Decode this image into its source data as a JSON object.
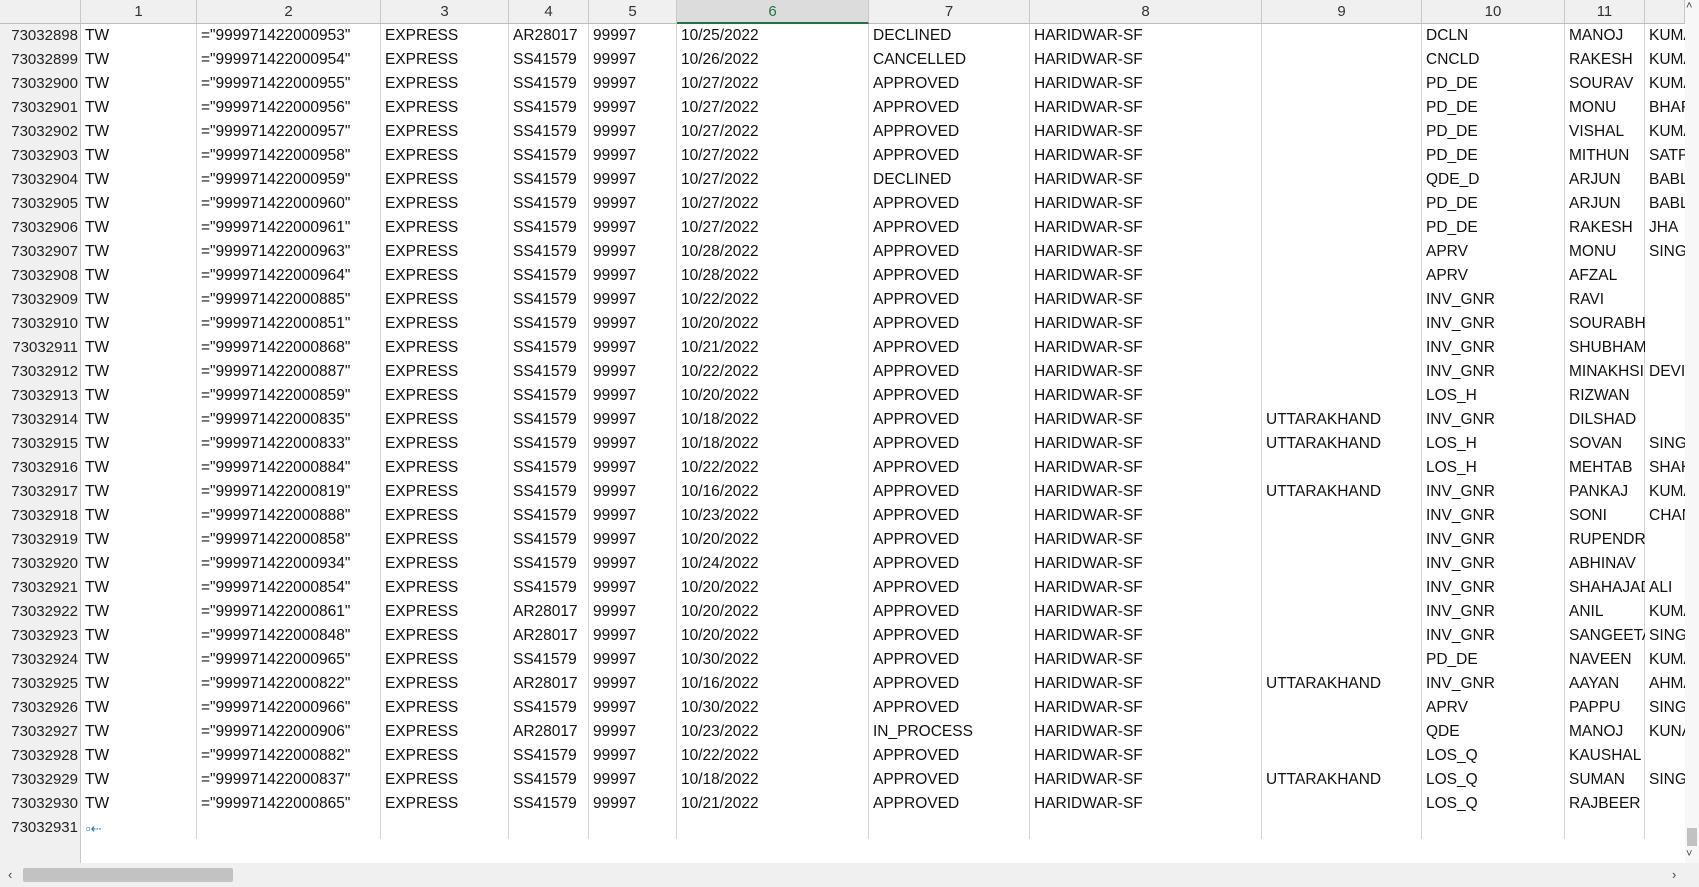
{
  "columns": [
    "1",
    "2",
    "3",
    "4",
    "5",
    "6",
    "7",
    "8",
    "9",
    "10",
    "11"
  ],
  "selected_column": "6",
  "rows": [
    {
      "id": "73032898",
      "cells": [
        "TW",
        "=\"999971422000953\"",
        "EXPRESS",
        "AR28017",
        "99997",
        "10/25/2022",
        "DECLINED",
        "HARIDWAR-SF",
        "",
        "DCLN",
        "MANOJ",
        "KUMAR"
      ]
    },
    {
      "id": "73032899",
      "cells": [
        "TW",
        "=\"999971422000954\"",
        "EXPRESS",
        "SS41579",
        "99997",
        "10/26/2022",
        "CANCELLED",
        "HARIDWAR-SF",
        "",
        "CNCLD",
        "RAKESH",
        "KUMAR"
      ]
    },
    {
      "id": "73032900",
      "cells": [
        "TW",
        "=\"999971422000955\"",
        "EXPRESS",
        "SS41579",
        "99997",
        "10/27/2022",
        "APPROVED",
        "HARIDWAR-SF",
        "",
        "PD_DE",
        "SOURAV",
        "KUMAR"
      ]
    },
    {
      "id": "73032901",
      "cells": [
        "TW",
        "=\"999971422000956\"",
        "EXPRESS",
        "SS41579",
        "99997",
        "10/27/2022",
        "APPROVED",
        "HARIDWAR-SF",
        "",
        "PD_DE",
        "MONU",
        "BHARDWAJ"
      ]
    },
    {
      "id": "73032902",
      "cells": [
        "TW",
        "=\"999971422000957\"",
        "EXPRESS",
        "SS41579",
        "99997",
        "10/27/2022",
        "APPROVED",
        "HARIDWAR-SF",
        "",
        "PD_DE",
        "VISHAL",
        "KUMAR"
      ]
    },
    {
      "id": "73032903",
      "cells": [
        "TW",
        "=\"999971422000958\"",
        "EXPRESS",
        "SS41579",
        "99997",
        "10/27/2022",
        "APPROVED",
        "HARIDWAR-SF",
        "",
        "PD_DE",
        "MITHUN",
        "SATPATHY"
      ]
    },
    {
      "id": "73032904",
      "cells": [
        "TW",
        "=\"999971422000959\"",
        "EXPRESS",
        "SS41579",
        "99997",
        "10/27/2022",
        "DECLINED",
        "HARIDWAR-SF",
        "",
        "QDE_D",
        "ARJUN",
        "BABLU"
      ]
    },
    {
      "id": "73032905",
      "cells": [
        "TW",
        "=\"999971422000960\"",
        "EXPRESS",
        "SS41579",
        "99997",
        "10/27/2022",
        "APPROVED",
        "HARIDWAR-SF",
        "",
        "PD_DE",
        "ARJUN",
        "BABLU"
      ]
    },
    {
      "id": "73032906",
      "cells": [
        "TW",
        "=\"999971422000961\"",
        "EXPRESS",
        "SS41579",
        "99997",
        "10/27/2022",
        "APPROVED",
        "HARIDWAR-SF",
        "",
        "PD_DE",
        "RAKESH",
        "JHA"
      ]
    },
    {
      "id": "73032907",
      "cells": [
        "TW",
        "=\"999971422000963\"",
        "EXPRESS",
        "SS41579",
        "99997",
        "10/28/2022",
        "APPROVED",
        "HARIDWAR-SF",
        "",
        "APRV",
        "MONU",
        "SINGH"
      ]
    },
    {
      "id": "73032908",
      "cells": [
        "TW",
        "=\"999971422000964\"",
        "EXPRESS",
        "SS41579",
        "99997",
        "10/28/2022",
        "APPROVED",
        "HARIDWAR-SF",
        "",
        "APRV",
        "AFZAL",
        ""
      ]
    },
    {
      "id": "73032909",
      "cells": [
        "TW",
        "=\"999971422000885\"",
        "EXPRESS",
        "SS41579",
        "99997",
        "10/22/2022",
        "APPROVED",
        "HARIDWAR-SF",
        "",
        "INV_GNR",
        "RAVI",
        ""
      ]
    },
    {
      "id": "73032910",
      "cells": [
        "TW",
        "=\"999971422000851\"",
        "EXPRESS",
        "SS41579",
        "99997",
        "10/20/2022",
        "APPROVED",
        "HARIDWAR-SF",
        "",
        "INV_GNR",
        "SOURABH",
        ""
      ]
    },
    {
      "id": "73032911",
      "cells": [
        "TW",
        "=\"999971422000868\"",
        "EXPRESS",
        "SS41579",
        "99997",
        "10/21/2022",
        "APPROVED",
        "HARIDWAR-SF",
        "",
        "INV_GNR",
        "SHUBHAM",
        ""
      ]
    },
    {
      "id": "73032912",
      "cells": [
        "TW",
        "=\"999971422000887\"",
        "EXPRESS",
        "SS41579",
        "99997",
        "10/22/2022",
        "APPROVED",
        "HARIDWAR-SF",
        "",
        "INV_GNR",
        "MINAKHSI",
        "DEVI"
      ]
    },
    {
      "id": "73032913",
      "cells": [
        "TW",
        "=\"999971422000859\"",
        "EXPRESS",
        "SS41579",
        "99997",
        "10/20/2022",
        "APPROVED",
        "HARIDWAR-SF",
        "",
        "LOS_H",
        "RIZWAN",
        ""
      ]
    },
    {
      "id": "73032914",
      "cells": [
        "TW",
        "=\"999971422000835\"",
        "EXPRESS",
        "SS41579",
        "99997",
        "10/18/2022",
        "APPROVED",
        "HARIDWAR-SF",
        "UTTARAKHAND",
        "INV_GNR",
        "DILSHAD",
        ""
      ]
    },
    {
      "id": "73032915",
      "cells": [
        "TW",
        "=\"999971422000833\"",
        "EXPRESS",
        "SS41579",
        "99997",
        "10/18/2022",
        "APPROVED",
        "HARIDWAR-SF",
        "UTTARAKHAND",
        "LOS_H",
        "SOVAN",
        "SINGH"
      ]
    },
    {
      "id": "73032916",
      "cells": [
        "TW",
        "=\"999971422000884\"",
        "EXPRESS",
        "SS41579",
        "99997",
        "10/22/2022",
        "APPROVED",
        "HARIDWAR-SF",
        "",
        "LOS_H",
        "MEHTAB",
        "SHAH"
      ]
    },
    {
      "id": "73032917",
      "cells": [
        "TW",
        "=\"999971422000819\"",
        "EXPRESS",
        "SS41579",
        "99997",
        "10/16/2022",
        "APPROVED",
        "HARIDWAR-SF",
        "UTTARAKHAND",
        "INV_GNR",
        "PANKAJ",
        "KUMAR"
      ]
    },
    {
      "id": "73032918",
      "cells": [
        "TW",
        "=\"999971422000888\"",
        "EXPRESS",
        "SS41579",
        "99997",
        "10/23/2022",
        "APPROVED",
        "HARIDWAR-SF",
        "",
        "INV_GNR",
        "SONI",
        "CHAND"
      ]
    },
    {
      "id": "73032919",
      "cells": [
        "TW",
        "=\"999971422000858\"",
        "EXPRESS",
        "SS41579",
        "99997",
        "10/20/2022",
        "APPROVED",
        "HARIDWAR-SF",
        "",
        "INV_GNR",
        "RUPENDRA",
        ""
      ]
    },
    {
      "id": "73032920",
      "cells": [
        "TW",
        "=\"999971422000934\"",
        "EXPRESS",
        "SS41579",
        "99997",
        "10/24/2022",
        "APPROVED",
        "HARIDWAR-SF",
        "",
        "INV_GNR",
        "ABHINAV",
        ""
      ]
    },
    {
      "id": "73032921",
      "cells": [
        "TW",
        "=\"999971422000854\"",
        "EXPRESS",
        "SS41579",
        "99997",
        "10/20/2022",
        "APPROVED",
        "HARIDWAR-SF",
        "",
        "INV_GNR",
        "SHAHAJAD",
        "ALI"
      ]
    },
    {
      "id": "73032922",
      "cells": [
        "TW",
        "=\"999971422000861\"",
        "EXPRESS",
        "AR28017",
        "99997",
        "10/20/2022",
        "APPROVED",
        "HARIDWAR-SF",
        "",
        "INV_GNR",
        "ANIL",
        "KUMAR"
      ]
    },
    {
      "id": "73032923",
      "cells": [
        "TW",
        "=\"999971422000848\"",
        "EXPRESS",
        "AR28017",
        "99997",
        "10/20/2022",
        "APPROVED",
        "HARIDWAR-SF",
        "",
        "INV_GNR",
        "SANGEETA",
        "SINGH"
      ]
    },
    {
      "id": "73032924",
      "cells": [
        "TW",
        "=\"999971422000965\"",
        "EXPRESS",
        "SS41579",
        "99997",
        "10/30/2022",
        "APPROVED",
        "HARIDWAR-SF",
        "",
        "PD_DE",
        "NAVEEN",
        "KUMAR"
      ]
    },
    {
      "id": "73032925",
      "cells": [
        "TW",
        "=\"999971422000822\"",
        "EXPRESS",
        "AR28017",
        "99997",
        "10/16/2022",
        "APPROVED",
        "HARIDWAR-SF",
        "UTTARAKHAND",
        "INV_GNR",
        "AAYAN",
        "AHMAD"
      ]
    },
    {
      "id": "73032926",
      "cells": [
        "TW",
        "=\"999971422000966\"",
        "EXPRESS",
        "SS41579",
        "99997",
        "10/30/2022",
        "APPROVED",
        "HARIDWAR-SF",
        "",
        "APRV",
        "PAPPU",
        "SINGH"
      ]
    },
    {
      "id": "73032927",
      "cells": [
        "TW",
        "=\"999971422000906\"",
        "EXPRESS",
        "AR28017",
        "99997",
        "10/23/2022",
        "IN_PROCESS",
        "HARIDWAR-SF",
        "",
        "QDE",
        "MANOJ",
        "KUNAR"
      ]
    },
    {
      "id": "73032928",
      "cells": [
        "TW",
        "=\"999971422000882\"",
        "EXPRESS",
        "SS41579",
        "99997",
        "10/22/2022",
        "APPROVED",
        "HARIDWAR-SF",
        "",
        "LOS_Q",
        "KAUSHAL",
        ""
      ]
    },
    {
      "id": "73032929",
      "cells": [
        "TW",
        "=\"999971422000837\"",
        "EXPRESS",
        "SS41579",
        "99997",
        "10/18/2022",
        "APPROVED",
        "HARIDWAR-SF",
        "UTTARAKHAND",
        "LOS_Q",
        "SUMAN",
        "SINGH"
      ]
    },
    {
      "id": "73032930",
      "cells": [
        "TW",
        "=\"999971422000865\"",
        "EXPRESS",
        "SS41579",
        "99997",
        "10/21/2022",
        "APPROVED",
        "HARIDWAR-SF",
        "",
        "LOS_Q",
        "RAJBEER",
        ""
      ]
    }
  ],
  "new_row": {
    "id": "73032931",
    "icon": "new-row-marker-icon"
  },
  "scrollbar": {
    "left_arrow": "‹",
    "right_arrow": "›",
    "up_arrow": "˄",
    "down_arrow": "˅"
  }
}
